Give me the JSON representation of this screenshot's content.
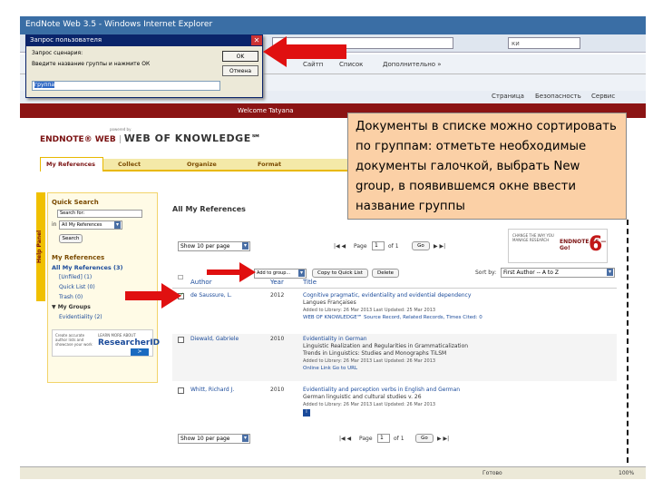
{
  "browser": {
    "title": "EndNote Web 3.5 - Windows Internet Explorer",
    "search_placeholder": "ки",
    "favorites_items": [
      "Сайтп",
      "Список",
      "Дополнительно »"
    ],
    "cmd_items": [
      "Страница",
      "Безопасность",
      "Сервис"
    ],
    "status_text": "Готово",
    "status_zoom": "100%"
  },
  "dialog": {
    "title": "Запрос пользователя",
    "line1": "Запрос сценария:",
    "line2": "Введите название группы и нажмите ОК",
    "ok_label": "OK",
    "cancel_label": "Отмена",
    "input_value": "группа"
  },
  "header": {
    "welcome": "Welcome Tatyana",
    "logo_endnote": "ENDNOTE® WEB",
    "logo_wok": "WEB OF KNOWLEDGE℠",
    "logo_powered": "powered by"
  },
  "tabs": [
    "My References",
    "Collect",
    "Organize",
    "Format"
  ],
  "help_panel": "Help Panel",
  "sidebar": {
    "quick_search_title": "Quick Search",
    "search_for_label": "Search for:",
    "in_label": "in",
    "in_select": "All My References",
    "search_button": "Search",
    "my_refs_title": "My References",
    "all_refs": "All My References (3)",
    "items": [
      "[Unfiled] (1)",
      "Quick List (0)",
      "Trash (0)",
      "My Groups",
      "Evidentiality (2)"
    ],
    "rid_create": "Create accurate author lists and showcase your work",
    "rid_learn": "LEARN MORE ABOUT",
    "rid_brand": "ResearcherID"
  },
  "main": {
    "title": "All My References",
    "show_select": "Show 10 per page",
    "page_label": "Page",
    "page_value": "1",
    "of_label": "of 1",
    "go_label": "Go",
    "group_select": "Add to group...",
    "copy_button": "Copy to Quick List",
    "delete_button": "Delete",
    "sort_label": "Sort by:",
    "sort_select": "First Author -- A to Z",
    "columns": [
      "Author",
      "Year",
      "Title"
    ],
    "endnote6_text": "ENDNOTE X6 — Go!",
    "endnote6_tag": "CHANGE THE WAY YOU MANAGE RESEARCH"
  },
  "rows": [
    {
      "author": "de Saussure, L.",
      "year": "2012",
      "title": "Cognitive pragmatic, evidentiality and evidential dependency",
      "journal": "Langues Françaises",
      "added": "Added to Library: 26 Mar 2013    Last Updated: 25 Mar 2013",
      "source": "WEB OF KNOWLEDGE℠   Source Record, Related Records, Times Cited: 0"
    },
    {
      "author": "Diewald, Gabriele",
      "year": "2010",
      "title": "Evidentiality in German",
      "journal": "Linguistic Realization and Regularities in Grammaticalization",
      "journal2": "Trends in Linguistics: Studies and Monographs TiLSM",
      "added": "Added to Library: 26 Mar 2013    Last Updated: 26 Mar 2013",
      "source": "Online Link   Go to URL"
    },
    {
      "author": "Whitt, Richard J.",
      "year": "2010",
      "title": "Evidentiality and perception verbs in English and German",
      "journal": "German linguistic and cultural studies v. 26",
      "added": "Added to Library: 26 Mar 2013    Last Updated: 26 Mar 2013",
      "source": ""
    }
  ],
  "callout": "Документы в списке можно сортировать по группам: отметьте необходимые документы галочкой, выбрать New group, в появившемся окне ввести название группы",
  "colors": {
    "accent": "#8b1414",
    "arrow": "#e01010",
    "callout_bg": "#fbd0a6"
  }
}
